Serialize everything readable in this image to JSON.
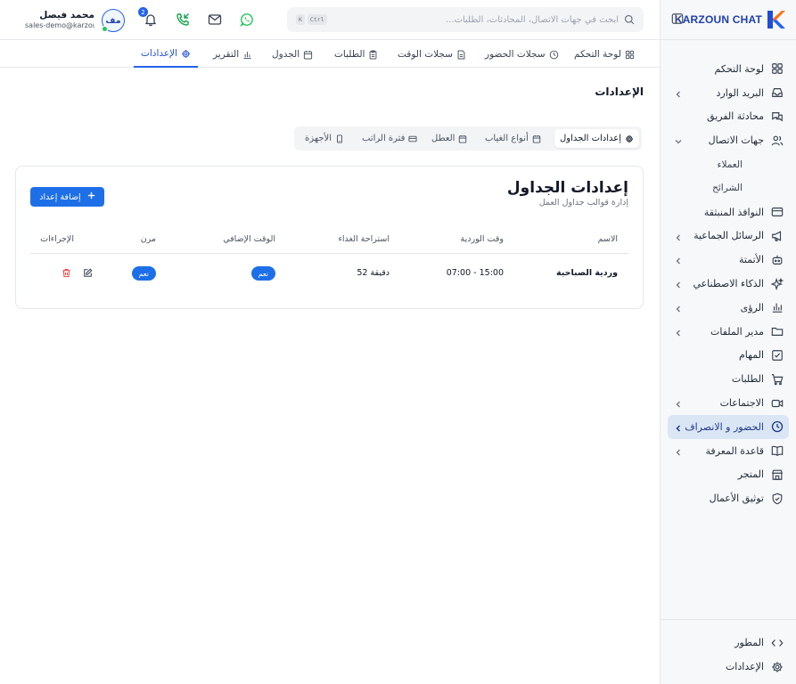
{
  "brand": {
    "name": "KARZOUN CHAT"
  },
  "search": {
    "placeholder": "ابحث في جهات الاتصال، المحادثات، الطلبات...",
    "kbd_ctrl": "Ctrl",
    "kbd_k": "K"
  },
  "notifications": {
    "count": "2"
  },
  "user": {
    "initials": "مف",
    "name": "محمد فيصل",
    "email": "sales-demo@karzoun..."
  },
  "tabs": [
    {
      "label": "لوحة التحكم",
      "icon": "grid-icon"
    },
    {
      "label": "سجلات الحضور",
      "icon": "clock-icon"
    },
    {
      "label": "سجلات الوقت",
      "icon": "file-icon"
    },
    {
      "label": "الطلبات",
      "icon": "clipboard-icon"
    },
    {
      "label": "الجدول",
      "icon": "calendar-icon"
    },
    {
      "label": "التقرير",
      "icon": "bar-chart-icon"
    },
    {
      "label": "الإعدادات",
      "icon": "gear-icon"
    }
  ],
  "page": {
    "title": "الإعدادات"
  },
  "subtabs": [
    {
      "label": "إعدادات الجداول",
      "icon": "gear-icon"
    },
    {
      "label": "أنواع الغياب",
      "icon": "calendar-icon"
    },
    {
      "label": "العطل",
      "icon": "calendar-icon"
    },
    {
      "label": "فترة الراتب",
      "icon": "card-icon"
    },
    {
      "label": "الأجهزة",
      "icon": "device-icon"
    }
  ],
  "card": {
    "title": "إعدادات الجداول",
    "subtitle": "إدارة قوالب جداول العمل",
    "add_button": "إضافة إعداد",
    "columns": [
      "الاسم",
      "وقت الوردية",
      "استراحة الغداء",
      "الوقت الإضافي",
      "مرن",
      "الإجراءات"
    ],
    "rows": [
      {
        "name": "وردية الصباحية",
        "shift": "07:00 - 15:00",
        "lunch": "52 دقيقة",
        "overtime": "نعم",
        "flexible": "نعم"
      }
    ]
  },
  "sidebar": {
    "items": [
      {
        "label": "لوحة التحكم",
        "icon": "grid-icon",
        "chevron": false
      },
      {
        "label": "البريد الوارد",
        "icon": "inbox-icon",
        "chevron": true
      },
      {
        "label": "محادثة الفريق",
        "icon": "chat-icon",
        "chevron": false
      },
      {
        "label": "جهات الاتصال",
        "icon": "users-icon",
        "chevron": true,
        "expanded": true
      },
      {
        "label": "العملاء",
        "sub": true
      },
      {
        "label": "الشرائح",
        "sub": true
      },
      {
        "label": "النوافذ المنبثقة",
        "icon": "window-icon",
        "chevron": false
      },
      {
        "label": "الرسائل الجماعية",
        "icon": "megaphone-icon",
        "chevron": true
      },
      {
        "label": "الأتمتة",
        "icon": "bot-icon",
        "chevron": true
      },
      {
        "label": "الذكاء الاصطناعي",
        "icon": "sparkles-icon",
        "chevron": true
      },
      {
        "label": "الرؤى",
        "icon": "bar-chart-icon",
        "chevron": true
      },
      {
        "label": "مدير الملفات",
        "icon": "folder-icon",
        "chevron": true
      },
      {
        "label": "المهام",
        "icon": "checkbox-icon",
        "chevron": false
      },
      {
        "label": "الطلبات",
        "icon": "cart-icon",
        "chevron": false
      },
      {
        "label": "الاجتماعات",
        "icon": "video-icon",
        "chevron": true
      },
      {
        "label": "الحضور و الانصراف",
        "icon": "clock-icon",
        "chevron": true,
        "active": true
      },
      {
        "label": "قاعدة المعرفة",
        "icon": "book-icon",
        "chevron": true
      },
      {
        "label": "المتجر",
        "icon": "store-icon",
        "chevron": false
      },
      {
        "label": "توثيق الأعمال",
        "icon": "shield-check-icon",
        "chevron": false
      }
    ],
    "bottom": [
      {
        "label": "المطور",
        "icon": "code-icon"
      },
      {
        "label": "الإعدادات",
        "icon": "gear-icon"
      }
    ]
  }
}
